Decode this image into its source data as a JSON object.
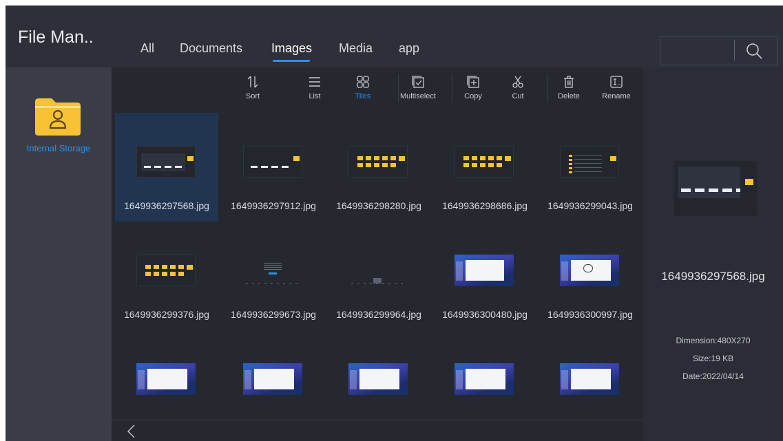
{
  "header": {
    "title": "File Man..",
    "tabs": [
      {
        "label": "All"
      },
      {
        "label": "Documents"
      },
      {
        "label": "Images"
      },
      {
        "label": "Media"
      },
      {
        "label": "app"
      }
    ],
    "active_tab": "Images"
  },
  "sidebar": {
    "storage_label": "Internal Storage"
  },
  "toolbar": {
    "sort": "Sort",
    "list": "List",
    "tiles": "Tiles",
    "multiselect": "Multiselect",
    "copy": "Copy",
    "cut": "Cut",
    "delete": "Delete",
    "rename": "Rename"
  },
  "files": [
    {
      "name": "1649936297568.jpg",
      "selected": true
    },
    {
      "name": "1649936297912.jpg"
    },
    {
      "name": "1649936298280.jpg"
    },
    {
      "name": "1649936298686.jpg"
    },
    {
      "name": "1649936299043.jpg"
    },
    {
      "name": "1649936299376.jpg"
    },
    {
      "name": "1649936299673.jpg"
    },
    {
      "name": "1649936299964.jpg"
    },
    {
      "name": "1649936300480.jpg"
    },
    {
      "name": "1649936300997.jpg"
    },
    {
      "name": ""
    },
    {
      "name": ""
    },
    {
      "name": ""
    },
    {
      "name": ""
    },
    {
      "name": ""
    }
  ],
  "details": {
    "name": "1649936297568.jpg",
    "dimension": "Dimension:480X270",
    "size": "Size:19 KB",
    "date": "Date:2022/04/14"
  },
  "colors": {
    "accent": "#2d8cf0",
    "background": "#25282f",
    "sidebar": "#3a3d46",
    "folder": "#f7c234"
  }
}
